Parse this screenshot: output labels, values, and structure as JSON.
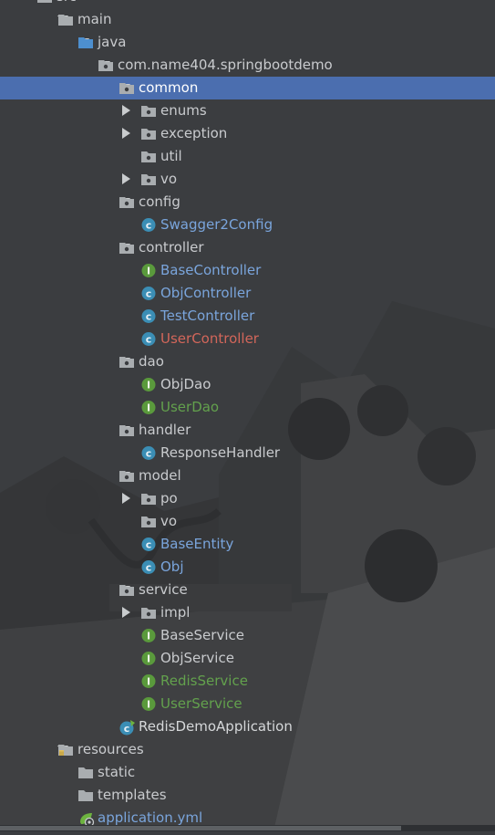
{
  "tree": [
    {
      "label": "src",
      "depth": 0,
      "arrow": "down",
      "icon": "folder-icon",
      "color": "default"
    },
    {
      "label": "main",
      "depth": 1,
      "arrow": "down",
      "icon": "folder-icon",
      "color": "default"
    },
    {
      "label": "java",
      "depth": 2,
      "arrow": "down",
      "icon": "source-folder-icon",
      "color": "default"
    },
    {
      "label": "com.name404.springbootdemo",
      "depth": 3,
      "arrow": "down",
      "icon": "package-icon",
      "color": "default"
    },
    {
      "label": "common",
      "depth": 4,
      "arrow": "down",
      "icon": "package-icon",
      "color": "default",
      "selected": true
    },
    {
      "label": "enums",
      "depth": 5,
      "arrow": "right",
      "icon": "package-icon",
      "color": "default"
    },
    {
      "label": "exception",
      "depth": 5,
      "arrow": "right",
      "icon": "package-icon",
      "color": "default"
    },
    {
      "label": "util",
      "depth": 5,
      "arrow": "none",
      "icon": "package-icon",
      "color": "default"
    },
    {
      "label": "vo",
      "depth": 5,
      "arrow": "right",
      "icon": "package-icon",
      "color": "default"
    },
    {
      "label": "config",
      "depth": 4,
      "arrow": "down",
      "icon": "package-icon",
      "color": "default"
    },
    {
      "label": "Swagger2Config",
      "depth": 5,
      "arrow": "none",
      "icon": "class-icon",
      "color": "blue"
    },
    {
      "label": "controller",
      "depth": 4,
      "arrow": "down",
      "icon": "package-icon",
      "color": "default"
    },
    {
      "label": "BaseController",
      "depth": 5,
      "arrow": "none",
      "icon": "interface-icon",
      "color": "blue"
    },
    {
      "label": "ObjController",
      "depth": 5,
      "arrow": "none",
      "icon": "class-icon",
      "color": "blue"
    },
    {
      "label": "TestController",
      "depth": 5,
      "arrow": "none",
      "icon": "class-icon",
      "color": "blue"
    },
    {
      "label": "UserController",
      "depth": 5,
      "arrow": "none",
      "icon": "class-icon",
      "color": "red"
    },
    {
      "label": "dao",
      "depth": 4,
      "arrow": "down",
      "icon": "package-icon",
      "color": "default"
    },
    {
      "label": "ObjDao",
      "depth": 5,
      "arrow": "none",
      "icon": "interface-icon",
      "color": "default"
    },
    {
      "label": "UserDao",
      "depth": 5,
      "arrow": "none",
      "icon": "interface-icon",
      "color": "green"
    },
    {
      "label": "handler",
      "depth": 4,
      "arrow": "down",
      "icon": "package-icon",
      "color": "default"
    },
    {
      "label": "ResponseHandler",
      "depth": 5,
      "arrow": "none",
      "icon": "class-icon",
      "color": "default"
    },
    {
      "label": "model",
      "depth": 4,
      "arrow": "down",
      "icon": "package-icon",
      "color": "default"
    },
    {
      "label": "po",
      "depth": 5,
      "arrow": "right",
      "icon": "package-icon",
      "color": "default"
    },
    {
      "label": "vo",
      "depth": 5,
      "arrow": "none",
      "icon": "package-icon",
      "color": "default"
    },
    {
      "label": "BaseEntity",
      "depth": 5,
      "arrow": "none",
      "icon": "class-icon",
      "color": "blue"
    },
    {
      "label": "Obj",
      "depth": 5,
      "arrow": "none",
      "icon": "class-icon",
      "color": "blue"
    },
    {
      "label": "service",
      "depth": 4,
      "arrow": "down",
      "icon": "package-icon",
      "color": "default"
    },
    {
      "label": "impl",
      "depth": 5,
      "arrow": "right",
      "icon": "package-icon",
      "color": "default"
    },
    {
      "label": "BaseService",
      "depth": 5,
      "arrow": "none",
      "icon": "interface-icon",
      "color": "default"
    },
    {
      "label": "ObjService",
      "depth": 5,
      "arrow": "none",
      "icon": "interface-icon",
      "color": "default"
    },
    {
      "label": "RedisService",
      "depth": 5,
      "arrow": "none",
      "icon": "interface-icon",
      "color": "green"
    },
    {
      "label": "UserService",
      "depth": 5,
      "arrow": "none",
      "icon": "interface-icon",
      "color": "green"
    },
    {
      "label": "RedisDemoApplication",
      "depth": 4,
      "arrow": "none",
      "icon": "spring-boot-class-icon",
      "color": "white"
    },
    {
      "label": "resources",
      "depth": 1,
      "arrow": "down",
      "icon": "resources-folder-icon",
      "color": "default"
    },
    {
      "label": "static",
      "depth": 2,
      "arrow": "none",
      "icon": "folder-icon",
      "color": "default"
    },
    {
      "label": "templates",
      "depth": 2,
      "arrow": "none",
      "icon": "folder-icon",
      "color": "default"
    },
    {
      "label": "application.yml",
      "depth": 2,
      "arrow": "none",
      "icon": "spring-yml-icon",
      "color": "blue"
    }
  ],
  "colors": {
    "selection": "#4b6eaf",
    "text": "#c9cbce",
    "modified": "#7aa5dc",
    "new": "#63a14d",
    "error": "#d2665a"
  }
}
